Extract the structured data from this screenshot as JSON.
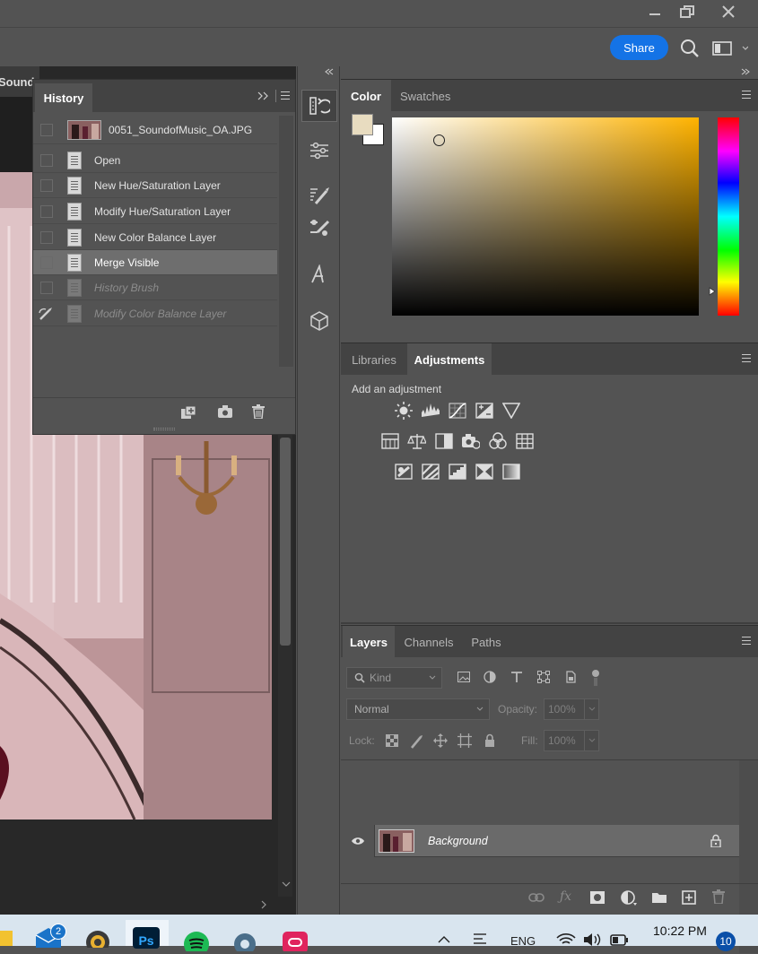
{
  "window": {
    "minimize_icon": "minimize-icon",
    "restore_icon": "restore-icon",
    "close_icon": "close-icon"
  },
  "optbar": {
    "share_label": "Share"
  },
  "document": {
    "tab_label": "SoundofM"
  },
  "history": {
    "tab_label": "History",
    "snapshot_label": "0051_SoundofMusic_OA.JPG",
    "items": [
      {
        "label": "Open"
      },
      {
        "label": "New Hue/Saturation Layer"
      },
      {
        "label": "Modify Hue/Saturation Layer"
      },
      {
        "label": "New Color Balance Layer"
      },
      {
        "label": "Merge Visible"
      },
      {
        "label": "History Brush"
      },
      {
        "label": "Modify Color Balance Layer"
      }
    ],
    "selected_item": "Merge Visible"
  },
  "color_panel": {
    "tabs": [
      {
        "label": "Color"
      },
      {
        "label": "Swatches"
      }
    ],
    "foreground": "#e8dcc0",
    "background": "#ffffff",
    "hue_color": "#ffb300"
  },
  "adjustments_panel": {
    "tabs": [
      {
        "label": "Libraries"
      },
      {
        "label": "Adjustments"
      }
    ],
    "heading": "Add an adjustment"
  },
  "layers_panel": {
    "tabs": [
      {
        "label": "Layers"
      },
      {
        "label": "Channels"
      },
      {
        "label": "Paths"
      }
    ],
    "filter_placeholder": "Kind",
    "blend_mode": "Normal",
    "opacity_label": "Opacity:",
    "opacity_value": "100%",
    "lock_label": "Lock:",
    "fill_label": "Fill:",
    "fill_value": "100%",
    "layers": [
      {
        "name": "Background"
      }
    ]
  },
  "taskbar": {
    "mail_badge": "2",
    "lang": "ENG",
    "time": "10:22 PM",
    "notification_count": "10"
  }
}
